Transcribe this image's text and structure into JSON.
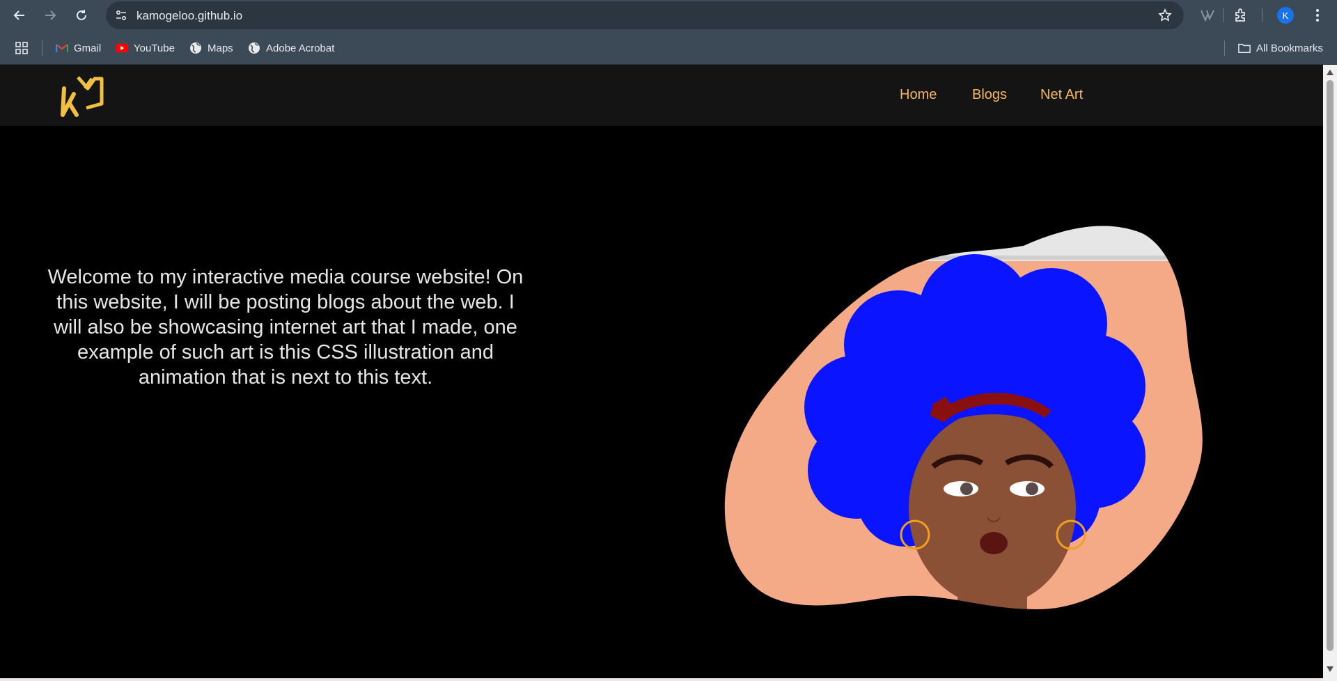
{
  "browser": {
    "url": "kamogeloo.github.io",
    "profile_initial": "K",
    "bookmarks": [
      {
        "label": "Gmail",
        "icon": "gmail-icon"
      },
      {
        "label": "YouTube",
        "icon": "youtube-icon"
      },
      {
        "label": "Maps",
        "icon": "globe-icon"
      },
      {
        "label": "Adobe Acrobat",
        "icon": "globe-icon"
      }
    ],
    "all_bookmarks_label": "All Bookmarks",
    "colors": {
      "chrome": "#3c4a57",
      "omnibox": "#2b3640"
    }
  },
  "site": {
    "nav": {
      "home": "Home",
      "blogs": "Blogs",
      "net_art": "Net Art"
    },
    "hero_text": "Welcome to my interactive media course website! On this website, I will be posting blogs about the web. I will also be showcasing internet art that I made, one example of such art is this CSS illustration and animation that is next to this text.",
    "colors": {
      "nav_link": "#f5b760",
      "logo": "#f2c040",
      "hair": "#0a14ff",
      "skin": "#8a5137",
      "background_blob": "#f4a987"
    }
  }
}
